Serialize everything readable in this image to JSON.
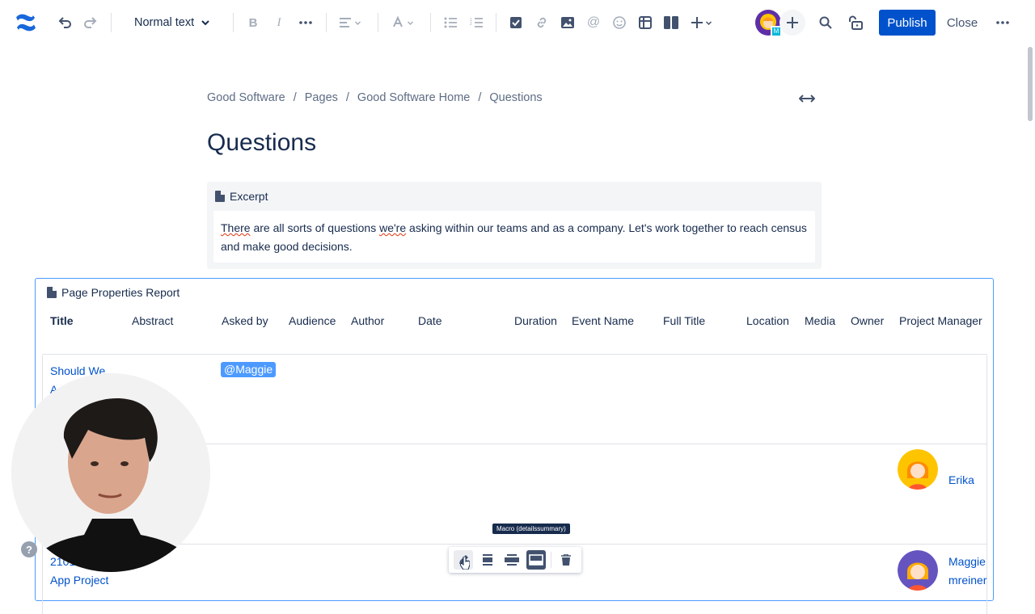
{
  "toolbar": {
    "text_style": "Normal text",
    "publish_label": "Publish",
    "close_label": "Close",
    "avatar_badge": "M"
  },
  "breadcrumbs": [
    "Good Software",
    "Pages",
    "Good Software Home",
    "Questions"
  ],
  "page": {
    "title": "Questions"
  },
  "excerpt": {
    "label": "Excerpt",
    "text_start": "There",
    "text_mid1": " are all sorts of questions ",
    "text_squig": "we're",
    "text_end": " asking within our teams and as a company. Let's work together to reach census and make good decisions."
  },
  "report": {
    "label": "Page Properties Report",
    "columns": [
      "Title",
      "Abstract",
      "Asked by",
      "Audience",
      "Author",
      "Date",
      "Duration",
      "Event Name",
      "Full Title",
      "Location",
      "Media",
      "Owner",
      "Project Manager"
    ],
    "rows": [
      {
        "title_line1": "Should We",
        "title_line2": "A",
        "asked_by": "@Maggie"
      },
      {
        "owner": "Erika"
      },
      {
        "title_line1": "2101",
        "title_line2": "App Project",
        "owner_line1": "Maggie",
        "owner_line2": "mreiner"
      }
    ]
  },
  "floating_toolbar": {
    "tooltip": "Macro (detailssummary)"
  },
  "help": {
    "glyph": "?"
  }
}
